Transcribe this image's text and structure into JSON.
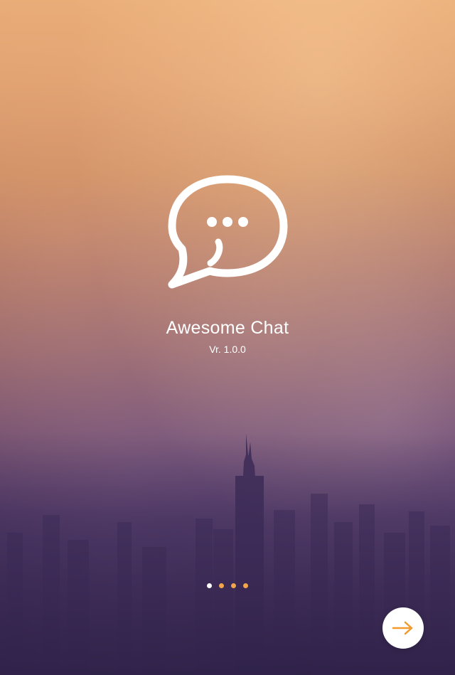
{
  "app": {
    "title": "Awesome Chat",
    "version": "Vr. 1.0.0"
  },
  "logo": {
    "icon": "chat-bubble-icon"
  },
  "pager": {
    "total": 4,
    "active_index": 0,
    "active_color": "#ffffff",
    "inactive_color": "#f2a54a"
  },
  "next_button": {
    "icon": "arrow-right-icon",
    "icon_color": "#f29a2e",
    "background": "#ffffff"
  }
}
